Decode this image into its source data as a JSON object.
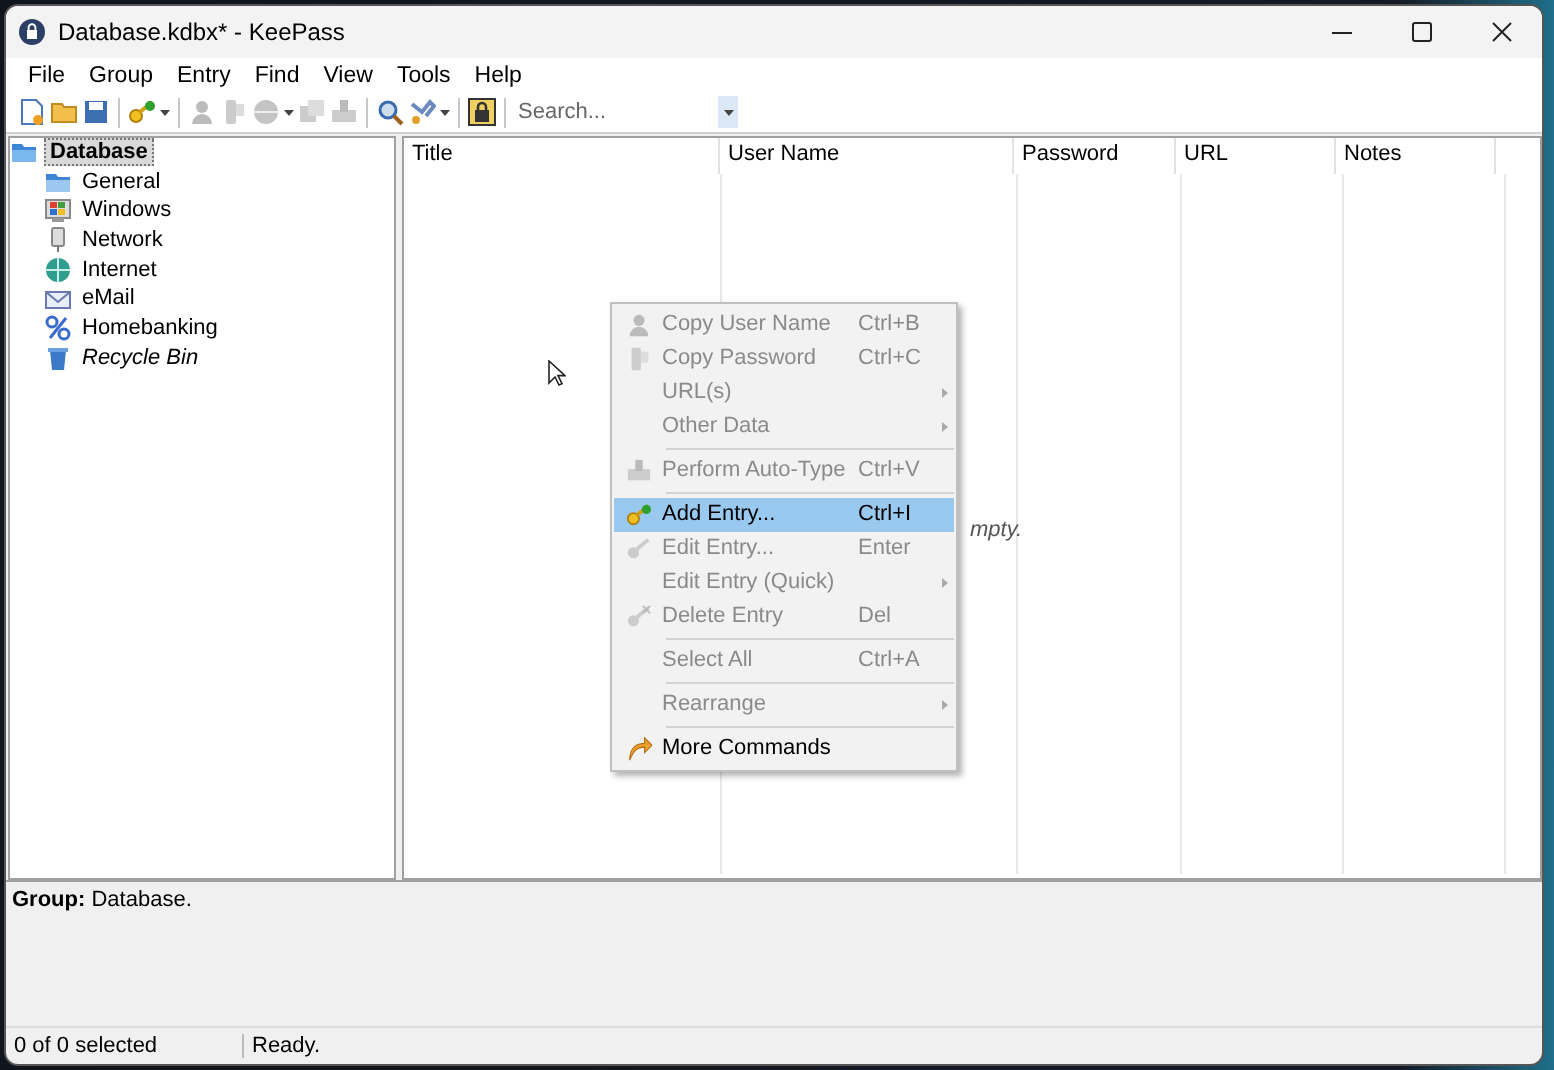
{
  "window": {
    "title": "Database.kdbx* - KeePass"
  },
  "menu_bar": [
    "File",
    "Group",
    "Entry",
    "Find",
    "View",
    "Tools",
    "Help"
  ],
  "toolbar": {
    "search": {
      "placeholder": "Search..."
    }
  },
  "tree": [
    {
      "label": "Database",
      "selected": true,
      "kind": "database",
      "children": [
        {
          "label": "General",
          "selected": false,
          "kind": "folder"
        },
        {
          "label": "Windows",
          "selected": false,
          "kind": "windows"
        },
        {
          "label": "Network",
          "selected": false,
          "kind": "network"
        },
        {
          "label": "Internet",
          "selected": false,
          "kind": "internet"
        },
        {
          "label": "eMail",
          "selected": false,
          "kind": "email"
        },
        {
          "label": "Homebanking",
          "selected": false,
          "kind": "banking"
        },
        {
          "label": "Recycle Bin",
          "selected": false,
          "kind": "recycle-bin"
        }
      ]
    }
  ],
  "table": {
    "columns": [
      "Title",
      "User Name",
      "Password",
      "URL",
      "Notes"
    ],
    "empty_message": "mpty."
  },
  "context_menu": [
    {
      "kind": "item",
      "label": "Copy User Name",
      "shortcut": "Ctrl+B",
      "disabled": true,
      "selected": false,
      "submenu": false
    },
    {
      "kind": "item",
      "label": "Copy Password",
      "shortcut": "Ctrl+C",
      "disabled": true,
      "selected": false,
      "submenu": false
    },
    {
      "kind": "item",
      "label": "URL(s)",
      "disabled": true,
      "selected": false,
      "submenu": true
    },
    {
      "kind": "item",
      "label": "Other Data",
      "disabled": true,
      "selected": false,
      "submenu": true
    },
    {
      "kind": "separator"
    },
    {
      "kind": "item",
      "label": "Perform Auto-Type",
      "shortcut": "Ctrl+V",
      "disabled": true,
      "selected": false,
      "submenu": false
    },
    {
      "kind": "separator"
    },
    {
      "kind": "item",
      "label": "Add Entry...",
      "shortcut": "Ctrl+I",
      "disabled": false,
      "selected": true,
      "submenu": false
    },
    {
      "kind": "item",
      "label": "Edit Entry...",
      "shortcut": "Enter",
      "disabled": true,
      "selected": false,
      "submenu": false
    },
    {
      "kind": "item",
      "label": "Edit Entry (Quick)",
      "disabled": true,
      "selected": false,
      "submenu": true
    },
    {
      "kind": "item",
      "label": "Delete Entry",
      "shortcut": "Del",
      "disabled": true,
      "selected": false,
      "submenu": false
    },
    {
      "kind": "separator"
    },
    {
      "kind": "item",
      "label": "Select All",
      "shortcut": "Ctrl+A",
      "disabled": true,
      "selected": false,
      "submenu": false
    },
    {
      "kind": "separator"
    },
    {
      "kind": "item",
      "label": "Rearrange",
      "disabled": true,
      "selected": false,
      "submenu": true
    },
    {
      "kind": "separator"
    },
    {
      "kind": "item",
      "label": "More Commands",
      "disabled": false,
      "selected": false,
      "submenu": false
    }
  ],
  "info_panel": {
    "label": "Group:",
    "value": "Database."
  },
  "status_bar": [
    "0 of 0 selected",
    "Ready."
  ]
}
